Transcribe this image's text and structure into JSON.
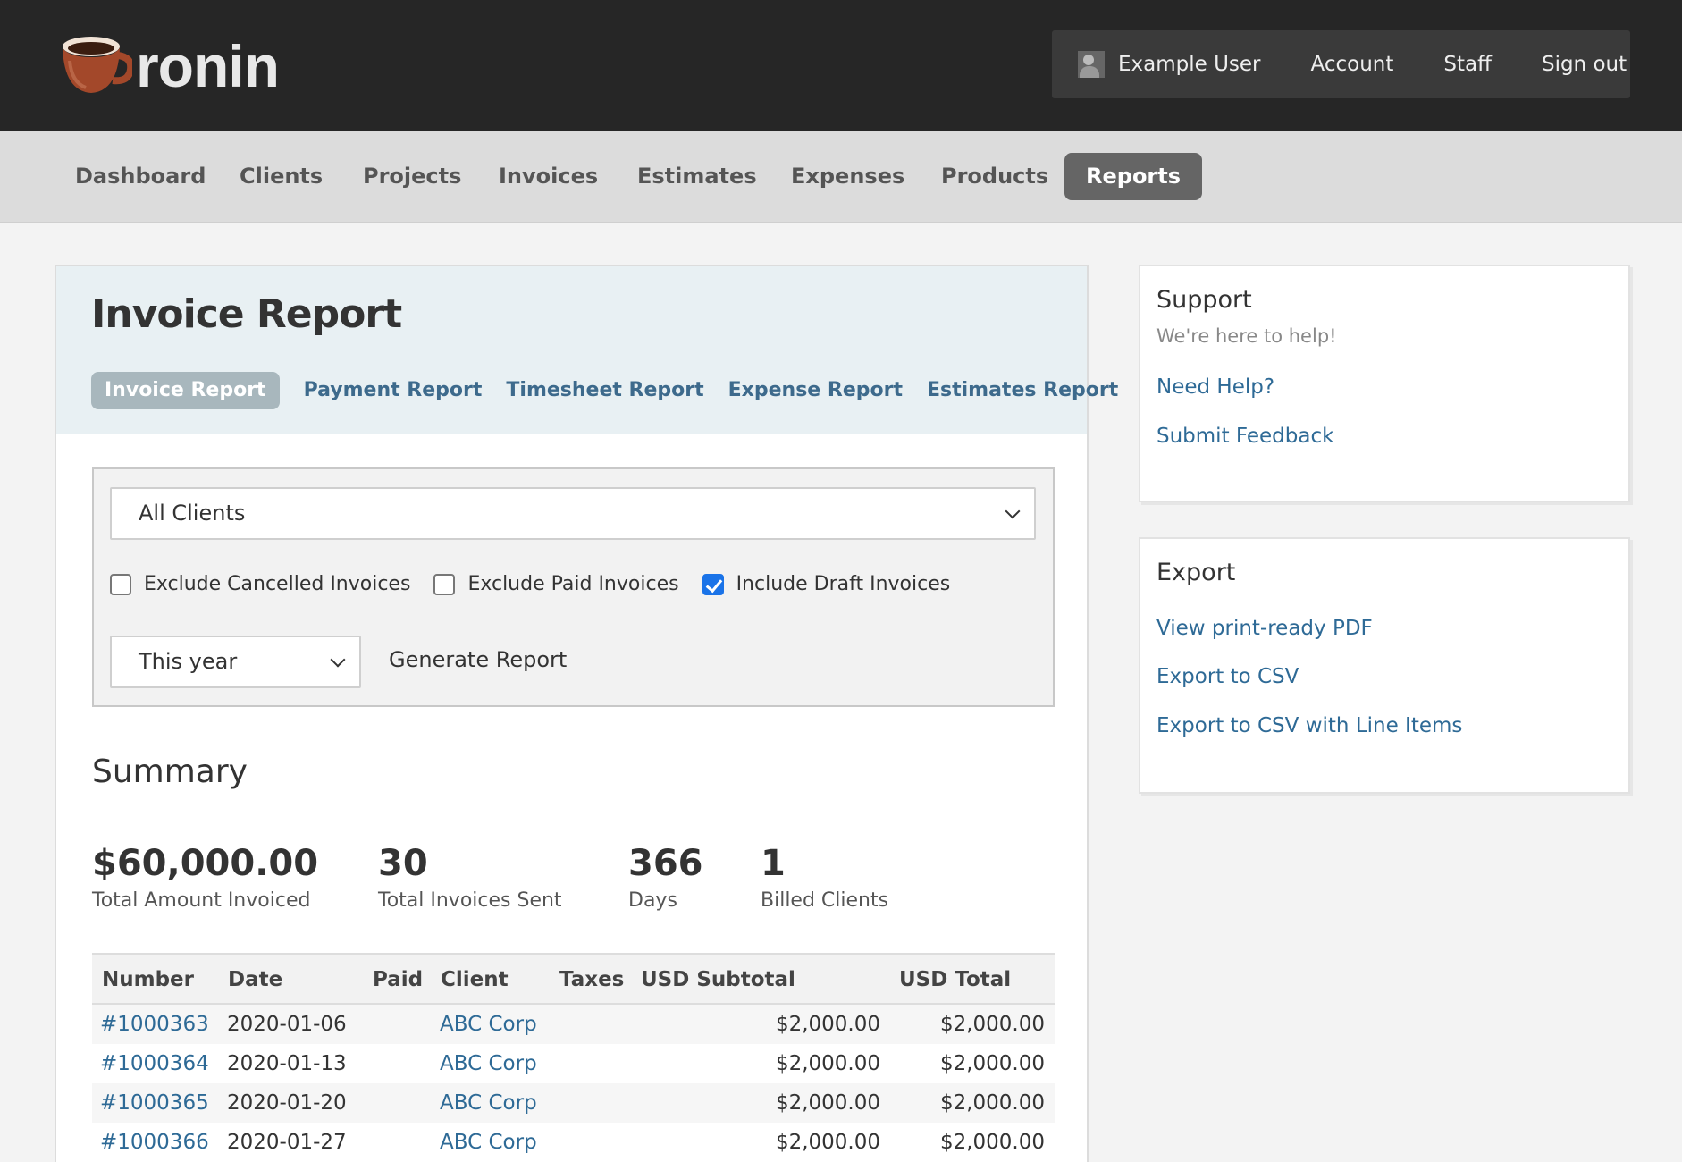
{
  "header": {
    "brand": "ronin",
    "user_name": "Example User",
    "links": [
      "Account",
      "Staff",
      "Sign out"
    ]
  },
  "nav": {
    "tabs": [
      "Dashboard",
      "Clients",
      "Projects",
      "Invoices",
      "Estimates",
      "Expenses",
      "Products",
      "Reports"
    ],
    "active": "Reports"
  },
  "report": {
    "title": "Invoice Report",
    "subtabs": [
      "Invoice Report",
      "Payment Report",
      "Timesheet Report",
      "Expense Report",
      "Estimates Report"
    ],
    "active_subtab": "Invoice Report"
  },
  "filters": {
    "client_select": "All Clients",
    "checkboxes": [
      {
        "label": "Exclude Cancelled Invoices",
        "checked": false
      },
      {
        "label": "Exclude Paid Invoices",
        "checked": false
      },
      {
        "label": "Include Draft Invoices",
        "checked": true
      }
    ],
    "range_select": "This year",
    "generate_label": "Generate Report"
  },
  "summary": {
    "title": "Summary",
    "stats": [
      {
        "value": "$60,000.00",
        "label": "Total Amount Invoiced"
      },
      {
        "value": "30",
        "label": "Total Invoices Sent"
      },
      {
        "value": "366",
        "label": "Days"
      },
      {
        "value": "1",
        "label": "Billed Clients"
      }
    ]
  },
  "table": {
    "headers": [
      "Number",
      "Date",
      "Paid",
      "Client",
      "Taxes",
      "USD Subtotal",
      "USD Total"
    ],
    "rows": [
      {
        "number": "#1000363",
        "date": "2020-01-06",
        "paid": "",
        "client": "ABC Corp",
        "taxes": "",
        "subtotal": "$2,000.00",
        "total": "$2,000.00"
      },
      {
        "number": "#1000364",
        "date": "2020-01-13",
        "paid": "",
        "client": "ABC Corp",
        "taxes": "",
        "subtotal": "$2,000.00",
        "total": "$2,000.00"
      },
      {
        "number": "#1000365",
        "date": "2020-01-20",
        "paid": "",
        "client": "ABC Corp",
        "taxes": "",
        "subtotal": "$2,000.00",
        "total": "$2,000.00"
      },
      {
        "number": "#1000366",
        "date": "2020-01-27",
        "paid": "",
        "client": "ABC Corp",
        "taxes": "",
        "subtotal": "$2,000.00",
        "total": "$2,000.00"
      }
    ]
  },
  "support": {
    "title": "Support",
    "subtitle": "We're here to help!",
    "links": [
      "Need Help?",
      "Submit Feedback"
    ]
  },
  "export": {
    "title": "Export",
    "links": [
      "View print-ready PDF",
      "Export to CSV",
      "Export to CSV with Line Items"
    ]
  }
}
